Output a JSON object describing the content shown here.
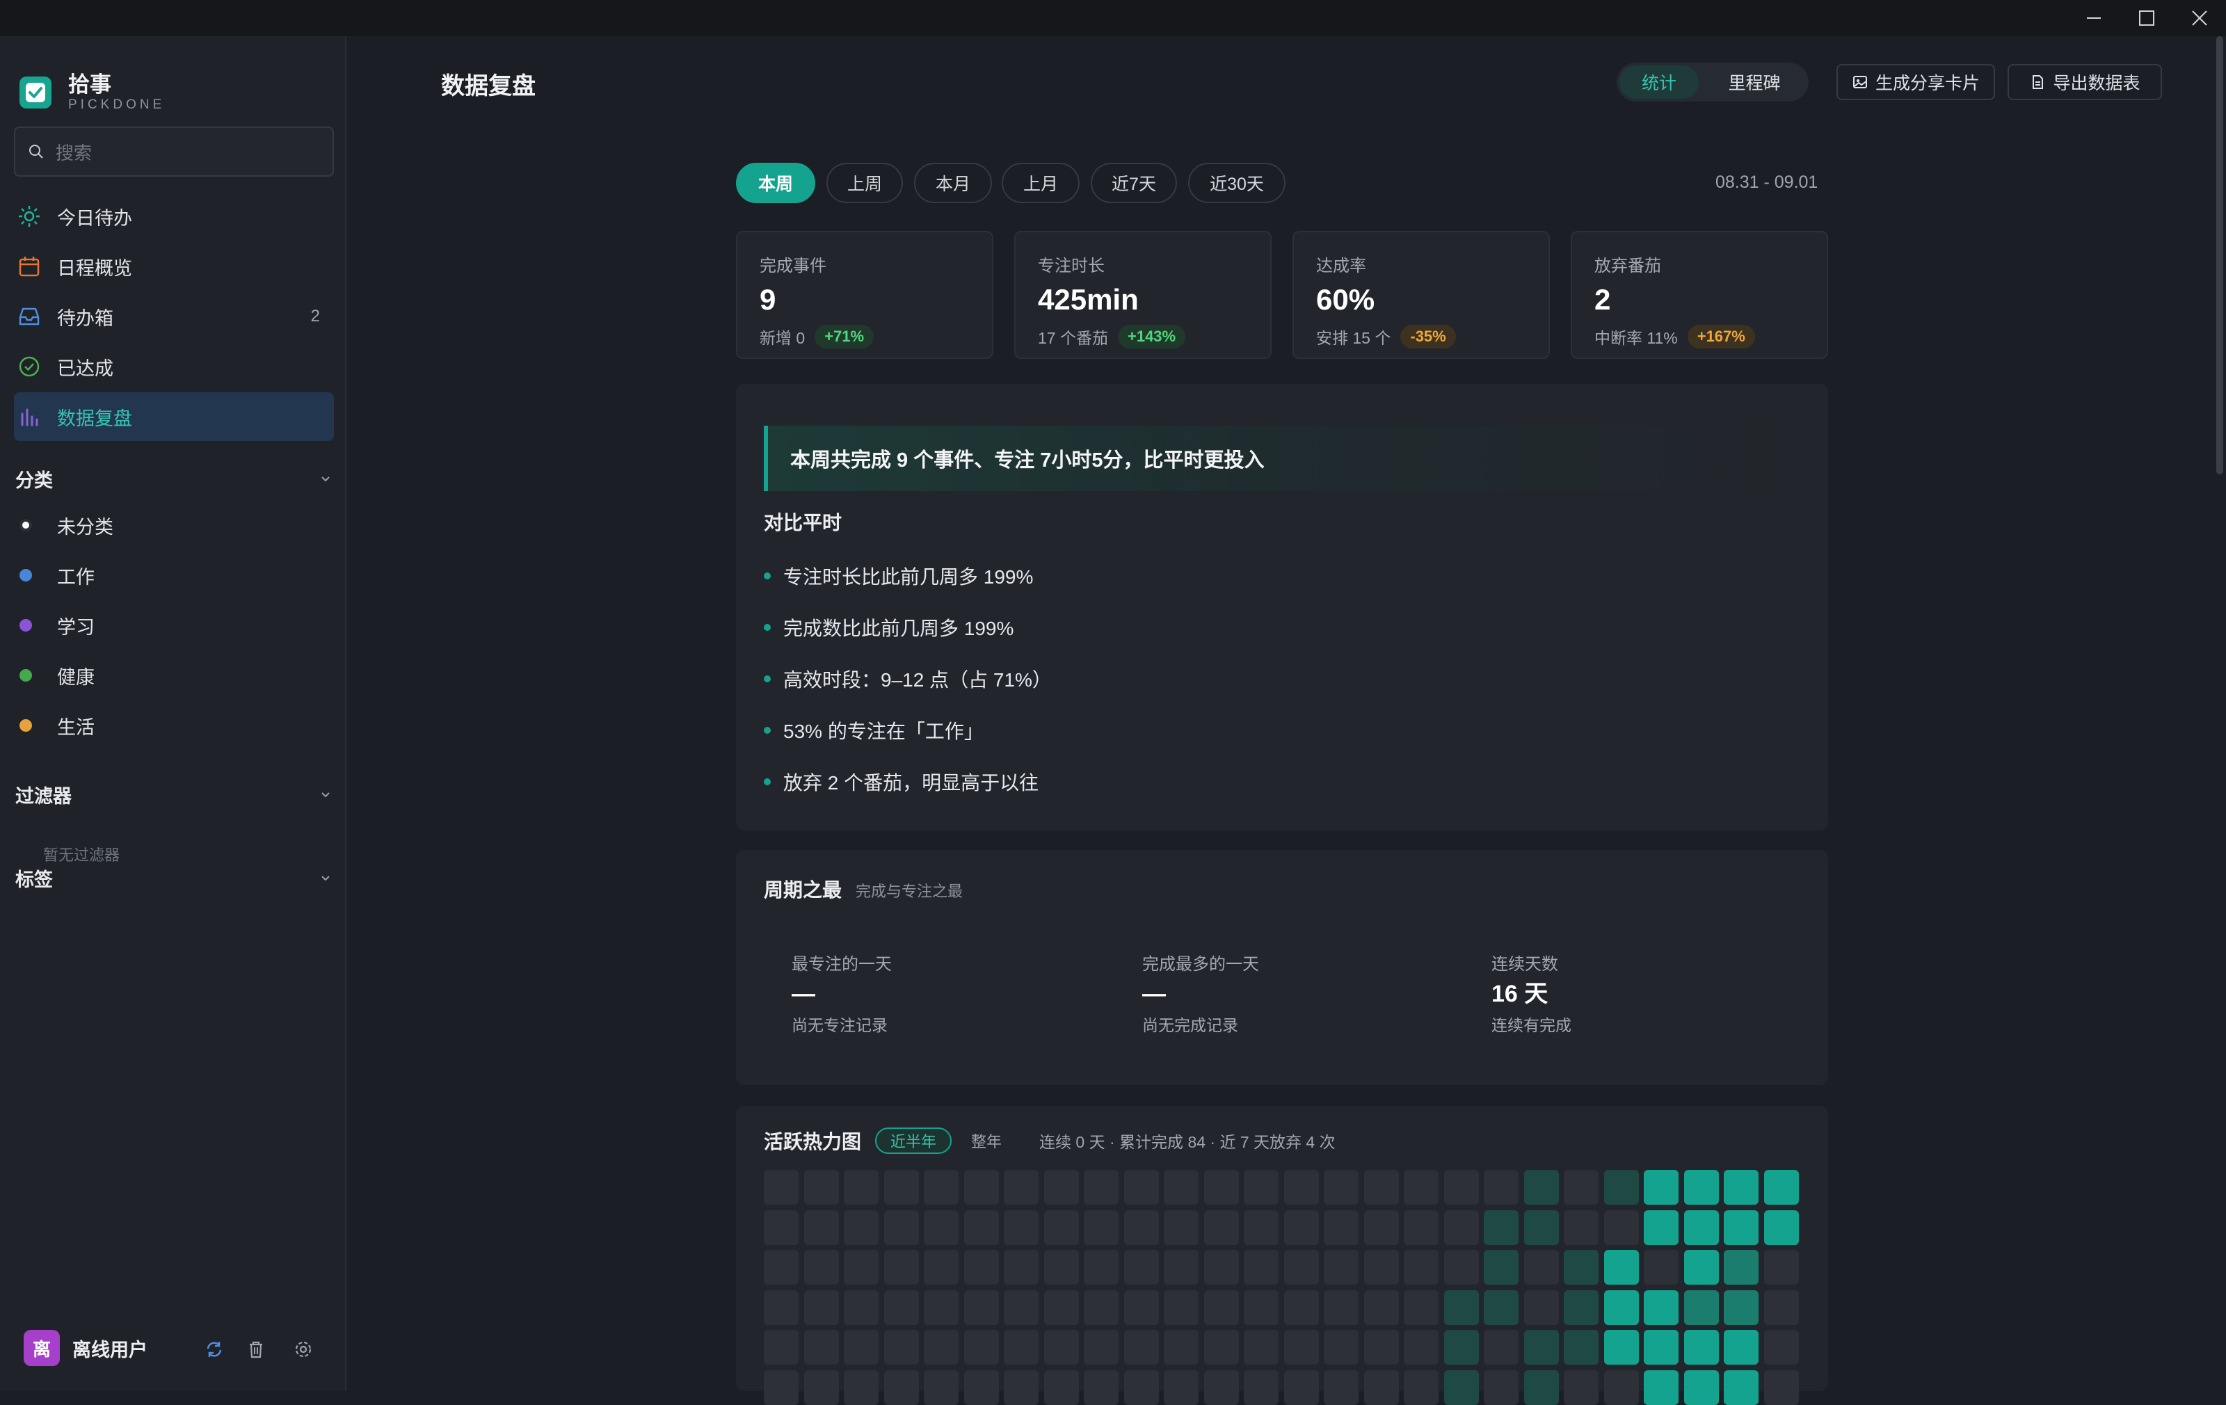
{
  "brand": {
    "name": "拾事",
    "sub": "PICKDONE"
  },
  "search": {
    "placeholder": "搜索"
  },
  "nav": [
    {
      "label": "今日待办",
      "icon": "sun-icon",
      "color": "#1fb59c"
    },
    {
      "label": "日程概览",
      "icon": "calendar-icon",
      "color": "#e8772e"
    },
    {
      "label": "待办箱",
      "icon": "inbox-icon",
      "color": "#4f8de0",
      "count": "2"
    },
    {
      "label": "已达成",
      "icon": "check-circle-icon",
      "color": "#4caf50"
    },
    {
      "label": "数据复盘",
      "icon": "bar-chart-icon",
      "color": "#8a63d2"
    }
  ],
  "sections": {
    "categories": "分类",
    "filters": "过滤器",
    "tags": "标签",
    "empty_filter": "暂无过滤器"
  },
  "categories": [
    {
      "label": "未分类",
      "color": "#ffffff"
    },
    {
      "label": "工作",
      "color": "#4a86d8"
    },
    {
      "label": "学习",
      "color": "#8a55d4"
    },
    {
      "label": "健康",
      "color": "#46a84e"
    },
    {
      "label": "生活",
      "color": "#e6a23c"
    }
  ],
  "user": {
    "avatar": "离",
    "name": "离线用户"
  },
  "page": {
    "title": "数据复盘"
  },
  "view_toggle": {
    "stats": "统计",
    "milestones": "里程碑"
  },
  "actions": {
    "share": "生成分享卡片",
    "export": "导出数据表"
  },
  "ranges": [
    "本周",
    "上周",
    "本月",
    "上月",
    "近7天",
    "近30天"
  ],
  "range_date": "08.31 - 09.01",
  "stats": [
    {
      "label": "完成事件",
      "value": "9",
      "sub": "新增 0",
      "delta": "+71%",
      "trend": "up"
    },
    {
      "label": "专注时长",
      "value": "425min",
      "sub": "17 个番茄",
      "delta": "+143%",
      "trend": "up"
    },
    {
      "label": "达成率",
      "value": "60%",
      "sub": "安排 15 个",
      "delta": "-35%",
      "trend": "down"
    },
    {
      "label": "放弃番茄",
      "value": "2",
      "sub": "中断率 11%",
      "delta": "+167%",
      "trend": "down"
    }
  ],
  "summary": {
    "banner": "本周共完成 9 个事件、专注 7小时5分，比平时更投入",
    "compare_title": "对比平时",
    "bullets": [
      "专注时长比此前几周多 199%",
      "完成数比此前几周多 199%",
      "高效时段：9–12 点（占 71%）",
      "53% 的专注在「工作」",
      "放弃 2 个番茄，明显高于以往"
    ]
  },
  "bests": {
    "title": "周期之最",
    "subtitle": "完成与专注之最",
    "items": [
      {
        "label": "最专注的一天",
        "value": "—",
        "note": "尚无专注记录"
      },
      {
        "label": "完成最多的一天",
        "value": "—",
        "note": "尚无完成记录"
      },
      {
        "label": "连续天数",
        "value": "16 天",
        "note": "连续有完成"
      }
    ]
  },
  "heatmap": {
    "title": "活跃热力图",
    "tab_active": "近半年",
    "tab_idle": "整年",
    "info": "连续 0 天 · 累计完成 84 · 近 7 天放弃 4 次",
    "levels": [
      [
        0,
        0,
        0,
        0,
        0,
        0,
        0,
        0,
        0,
        0,
        0,
        0,
        0,
        0,
        0,
        0,
        0,
        0,
        0,
        1,
        0,
        1,
        3,
        3,
        3,
        3
      ],
      [
        0,
        0,
        0,
        0,
        0,
        0,
        0,
        0,
        0,
        0,
        0,
        0,
        0,
        0,
        0,
        0,
        0,
        0,
        1,
        1,
        0,
        0,
        3,
        3,
        3,
        3
      ],
      [
        0,
        0,
        0,
        0,
        0,
        0,
        0,
        0,
        0,
        0,
        0,
        0,
        0,
        0,
        0,
        0,
        0,
        0,
        1,
        0,
        1,
        3,
        0,
        3,
        2,
        0
      ],
      [
        0,
        0,
        0,
        0,
        0,
        0,
        0,
        0,
        0,
        0,
        0,
        0,
        0,
        0,
        0,
        0,
        0,
        1,
        1,
        0,
        1,
        3,
        3,
        2,
        2,
        0
      ],
      [
        0,
        0,
        0,
        0,
        0,
        0,
        0,
        0,
        0,
        0,
        0,
        0,
        0,
        0,
        0,
        0,
        0,
        1,
        0,
        1,
        1,
        3,
        3,
        3,
        3,
        0
      ],
      [
        0,
        0,
        0,
        0,
        0,
        0,
        0,
        0,
        0,
        0,
        0,
        0,
        0,
        0,
        0,
        0,
        0,
        1,
        0,
        1,
        0,
        0,
        3,
        3,
        3,
        0
      ]
    ],
    "colors": [
      "#2d3037",
      "#1f4a44",
      "#1a7d6e",
      "#14a38e"
    ]
  }
}
